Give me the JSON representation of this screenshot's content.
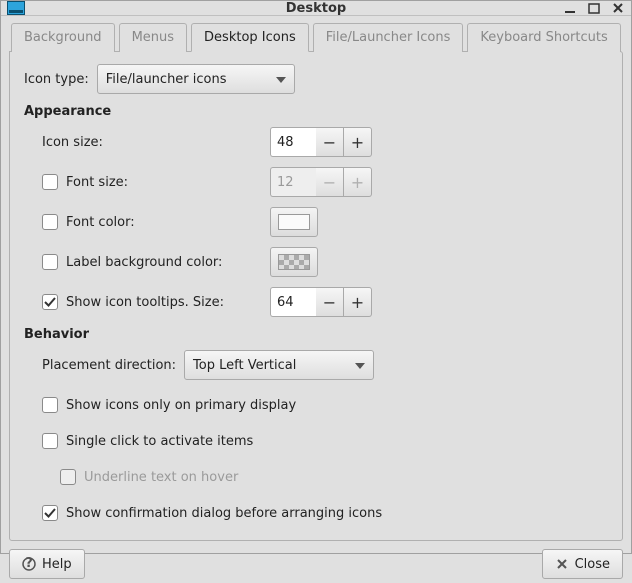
{
  "title": "Desktop",
  "tabs": {
    "items": [
      "Background",
      "Menus",
      "Desktop Icons",
      "File/Launcher Icons",
      "Keyboard Shortcuts"
    ],
    "active": 2
  },
  "iconType": {
    "label": "Icon type:",
    "value": "File/launcher icons"
  },
  "appearance": {
    "heading": "Appearance",
    "iconSize": {
      "label": "Icon size:",
      "value": "48"
    },
    "fontSize": {
      "label": "Font size:",
      "value": "12",
      "checked": false
    },
    "fontColor": {
      "label": "Font color:",
      "checked": false
    },
    "labelBg": {
      "label": "Label background color:",
      "checked": false
    },
    "tooltips": {
      "label": "Show icon tooltips. Size:",
      "value": "64",
      "checked": true
    }
  },
  "behavior": {
    "heading": "Behavior",
    "placement": {
      "label": "Placement direction:",
      "value": "Top Left Vertical"
    },
    "primaryOnly": {
      "label": "Show icons only on primary display",
      "checked": false
    },
    "singleClick": {
      "label": "Single click to activate items",
      "checked": false
    },
    "underline": {
      "label": "Underline text on hover",
      "checked": false
    },
    "confirmArrange": {
      "label": "Show confirmation dialog before arranging icons",
      "checked": true
    }
  },
  "footer": {
    "help": "Help",
    "close": "Close"
  },
  "glyphs": {
    "minus": "−",
    "plus": "+"
  }
}
